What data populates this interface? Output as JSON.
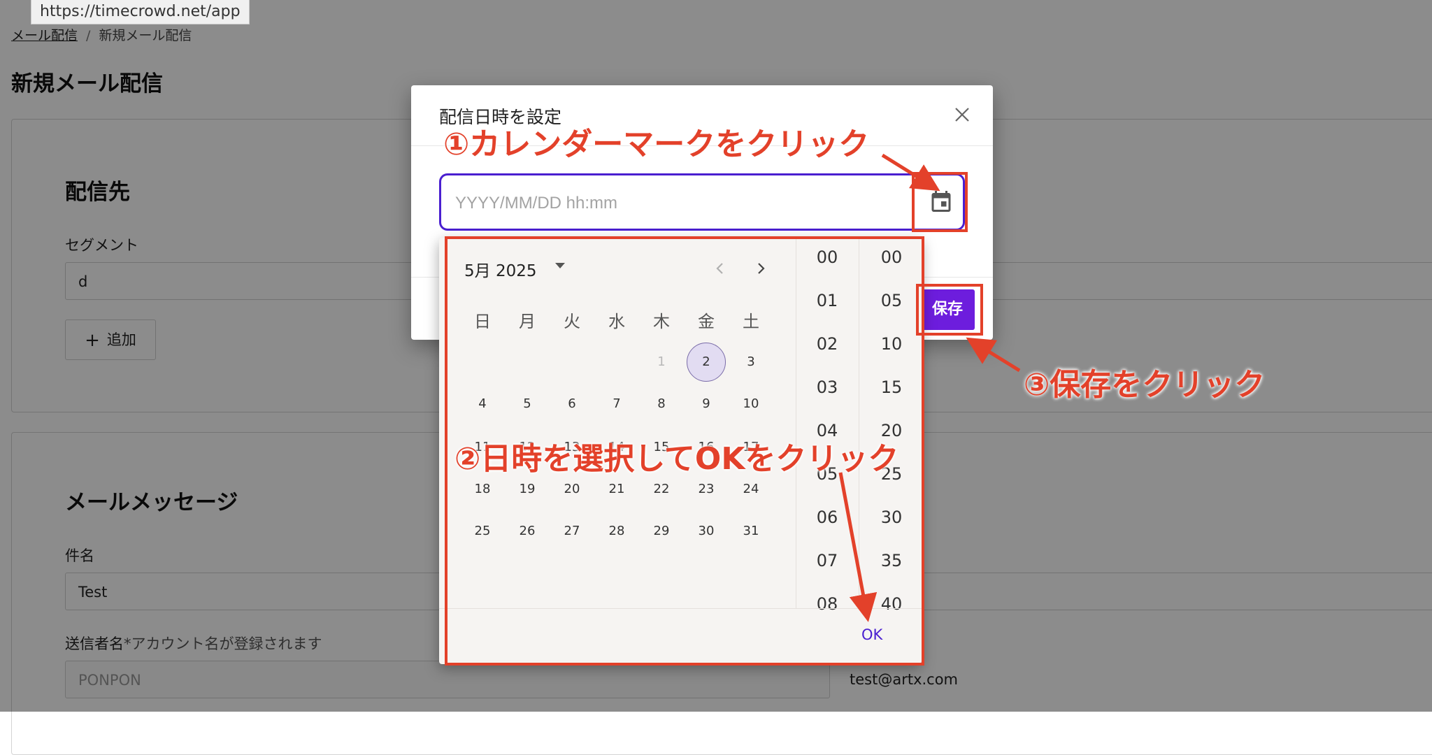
{
  "browser": {
    "url_tooltip": "https://timecrowd.net/app"
  },
  "breadcrumb": {
    "parent": "メール配信",
    "separator": "/",
    "current": "新規メール配信"
  },
  "page_title": "新規メール配信",
  "destination": {
    "title": "配信先",
    "segment_label": "セグメント",
    "segment_value": "d",
    "add_label": "追加"
  },
  "message": {
    "title": "メールメッセージ",
    "subject_label": "件名",
    "subject_value": "Test",
    "sender_label": "送信者名",
    "sender_hint": "*アカウント名が登録されます",
    "sender_value": "PONPON",
    "email_value": "test@artx.com"
  },
  "dialog": {
    "title": "配信日時を設定",
    "input_placeholder": "YYYY/MM/DD hh:mm",
    "save_label": "保存"
  },
  "picker": {
    "month_label": "5月 2025",
    "weekdays": [
      "日",
      "月",
      "火",
      "水",
      "木",
      "金",
      "土"
    ],
    "selected_day": "2",
    "hours": [
      "00",
      "01",
      "02",
      "03",
      "04",
      "05",
      "06",
      "07",
      "08"
    ],
    "minutes": [
      "00",
      "05",
      "10",
      "15",
      "20",
      "25",
      "30",
      "35",
      "40"
    ],
    "ok_label": "OK"
  },
  "annotations": {
    "step1": "①カレンダーマークをクリック",
    "step2": "②日時を選択してOKをクリック",
    "step3": "③保存をクリック",
    "color": "#e3412a"
  },
  "colors": {
    "accent": "#6d1ddd",
    "input_border": "#4a1fd0"
  }
}
